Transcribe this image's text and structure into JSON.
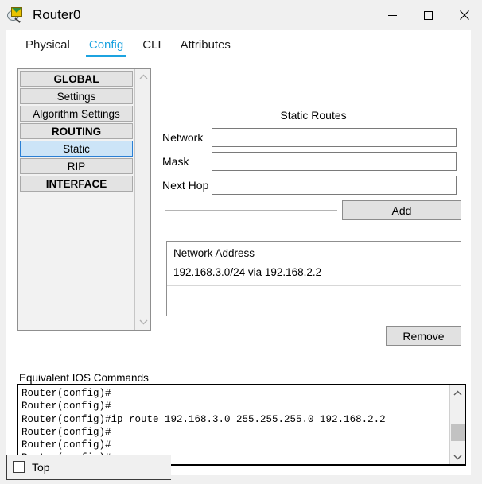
{
  "window": {
    "title": "Router0",
    "icon": "router-magnifier-icon",
    "controls": {
      "minimize": "minimize-icon",
      "maximize": "maximize-icon",
      "close": "close-icon"
    }
  },
  "tabs": [
    {
      "label": "Physical",
      "active": false
    },
    {
      "label": "Config",
      "active": true
    },
    {
      "label": "CLI",
      "active": false
    },
    {
      "label": "Attributes",
      "active": false
    }
  ],
  "sidebar": {
    "items": [
      {
        "label": "GLOBAL",
        "type": "header",
        "selected": false
      },
      {
        "label": "Settings",
        "type": "item",
        "selected": false
      },
      {
        "label": "Algorithm Settings",
        "type": "item",
        "selected": false
      },
      {
        "label": "ROUTING",
        "type": "header",
        "selected": false
      },
      {
        "label": "Static",
        "type": "item",
        "selected": true
      },
      {
        "label": "RIP",
        "type": "item",
        "selected": false
      },
      {
        "label": "INTERFACE",
        "type": "header",
        "selected": false
      }
    ],
    "scrollbar": {
      "up": "chevron-up-icon",
      "down": "chevron-down-icon"
    }
  },
  "static_routes": {
    "title": "Static Routes",
    "fields": {
      "network_label": "Network",
      "network_value": "",
      "network_placeholder": "",
      "mask_label": "Mask",
      "mask_value": "",
      "mask_placeholder": "",
      "next_hop_label": "Next Hop",
      "next_hop_value": "",
      "next_hop_placeholder": ""
    },
    "add_label": "Add",
    "remove_label": "Remove",
    "list_header": "Network Address",
    "entries": [
      "192.168.3.0/24 via 192.168.2.2"
    ]
  },
  "ios": {
    "label": "Equivalent IOS Commands",
    "lines": [
      "Router(config)#",
      "Router(config)#",
      "Router(config)#ip route 192.168.3.0 255.255.255.0 192.168.2.2",
      "Router(config)#",
      "Router(config)#",
      "Router(config)#"
    ],
    "scrollbar": {
      "up": "chevron-up-icon",
      "down": "chevron-down-icon"
    }
  },
  "footer": {
    "top_label": "Top",
    "top_checked": false
  },
  "colors": {
    "accent": "#1ca3e0",
    "selection": "#cce4f7",
    "selection_border": "#2a7fd4",
    "window_bg": "#f0f0f0",
    "content_bg": "#ffffff"
  }
}
